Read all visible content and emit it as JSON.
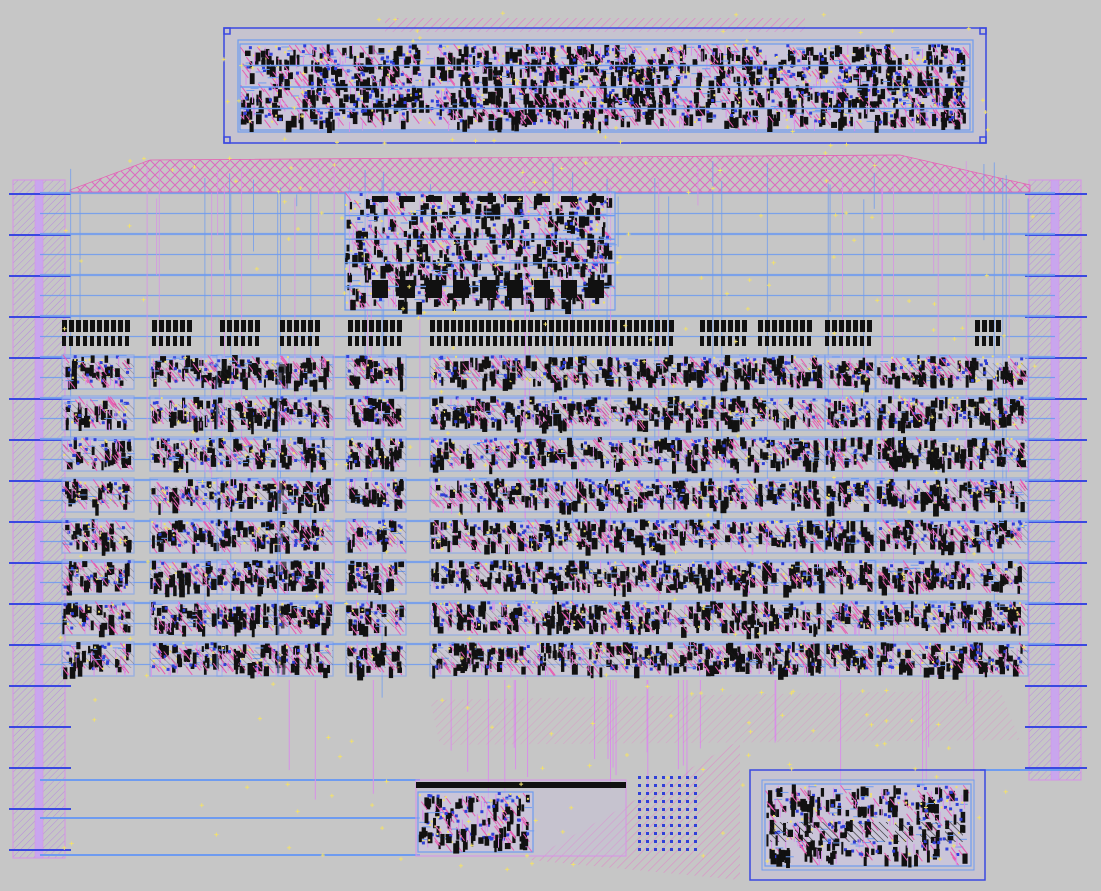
{
  "layout": {
    "blocks": [
      {
        "id": "top-macro",
        "kind": "dense-cells"
      },
      {
        "id": "left-rail",
        "kind": "power-rail"
      },
      {
        "id": "right-rail",
        "kind": "power-rail"
      },
      {
        "id": "decoder-block",
        "kind": "dense-cells"
      },
      {
        "id": "main-array",
        "kind": "cell-array",
        "rows": 8
      },
      {
        "id": "bottom-center-block",
        "kind": "dense-cells"
      },
      {
        "id": "bottom-right-macro",
        "kind": "dense-cells"
      }
    ],
    "colors": {
      "background": "#c6c6c6",
      "metal1": "#6e9bf0",
      "metal2": "#d890e8",
      "poly": "#e85ab0",
      "diffusion": "#2f3fd8",
      "contact": "#111111",
      "via": "#f0e070",
      "boundary": "#3a48e0"
    }
  }
}
